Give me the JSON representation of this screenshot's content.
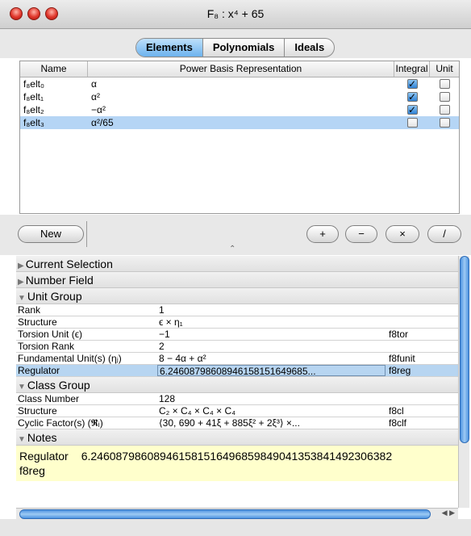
{
  "window": {
    "title": "F₈ : x⁴ + 65"
  },
  "tabs": [
    {
      "label": "Elements",
      "active": true
    },
    {
      "label": "Polynomials",
      "active": false
    },
    {
      "label": "Ideals",
      "active": false
    }
  ],
  "table": {
    "headers": [
      "Name",
      "Power Basis Representation",
      "Integral",
      "Unit"
    ],
    "rows": [
      {
        "name": "f₈elt₀",
        "rep": "α",
        "integral": true,
        "unit": false,
        "selected": false
      },
      {
        "name": "f₈elt₁",
        "rep": "α²",
        "integral": true,
        "unit": false,
        "selected": false
      },
      {
        "name": "f₈elt₂",
        "rep": "−α²",
        "integral": true,
        "unit": false,
        "selected": false
      },
      {
        "name": "f₈elt₃",
        "rep": "α²/65",
        "integral": false,
        "unit": false,
        "selected": true
      }
    ]
  },
  "buttons": {
    "new": "New",
    "plus": "+",
    "minus": "−",
    "times": "×",
    "divide": "/"
  },
  "details": {
    "current_selection": "Current Selection",
    "number_field": "Number Field",
    "unit_group": {
      "title": "Unit Group",
      "rows": [
        {
          "label": "Rank",
          "value": "1",
          "id": ""
        },
        {
          "label": "Structure",
          "value": "ϵ × η₁",
          "id": ""
        },
        {
          "label": "Torsion Unit (ϵ)",
          "value": "−1",
          "id": "f8tor"
        },
        {
          "label": "Torsion Rank",
          "value": "2",
          "id": ""
        },
        {
          "label": "Fundamental Unit(s) (ηⱼ)",
          "value": "8 − 4α + α²",
          "id": "f8funit"
        },
        {
          "label": "Regulator",
          "value": "6.24608798608946158151649685...",
          "id": "f8reg",
          "highlight": true
        }
      ]
    },
    "class_group": {
      "title": "Class Group",
      "rows": [
        {
          "label": "Class Number",
          "value": "128",
          "id": ""
        },
        {
          "label": "Structure",
          "value": "C₂ × C₄ × C₄ × C₄",
          "id": "f8cl"
        },
        {
          "label": "Cyclic Factor(s) (𝕽ᵢ)",
          "value": "⟨30, 690 + 41ξ + 885ξ² + 2ξ³⟩ ×...",
          "id": "f8clf"
        }
      ]
    },
    "notes": {
      "title": "Notes",
      "label": "Regulator",
      "value": "6.2460879860894615815164968598490413538414923063​82",
      "id": "f8reg"
    }
  },
  "colors": {
    "selection": "#b5d5f5",
    "notes_bg": "#ffffcc",
    "accent": "#4d93e0"
  }
}
